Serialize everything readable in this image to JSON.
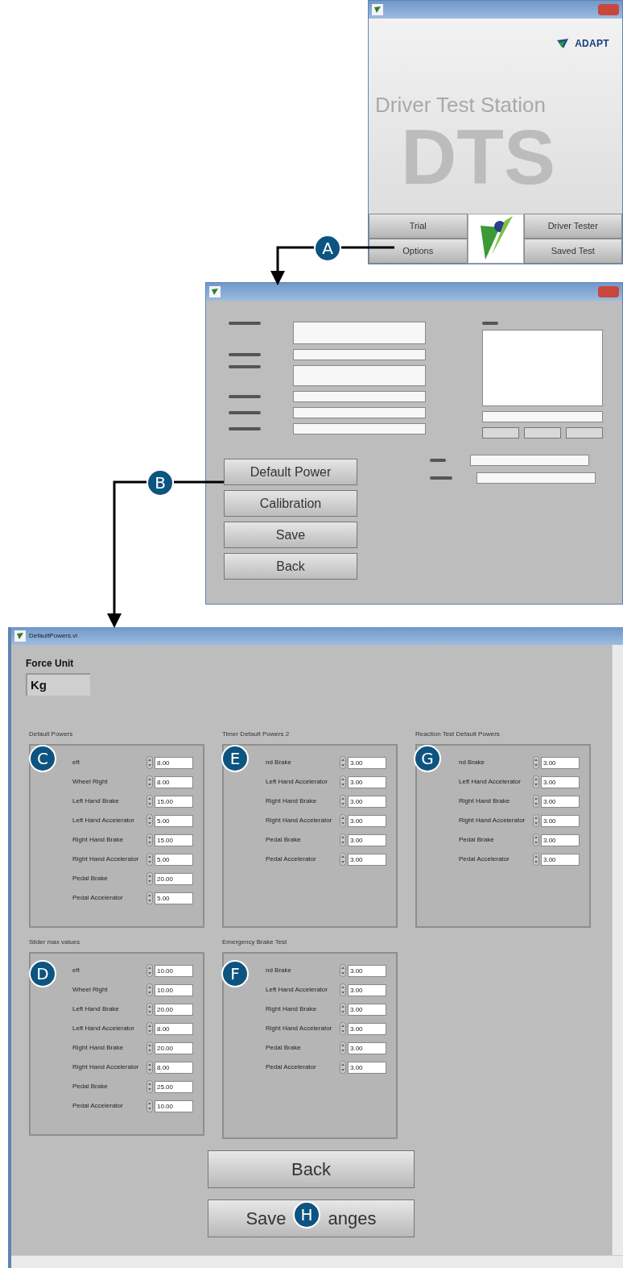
{
  "launcher": {
    "logo_text": "ADAPT",
    "watermark": "Driver Test Station",
    "watermark_letters": "DTS",
    "buttons": [
      {
        "label": "Trial"
      },
      {
        "label": "Driver Tester"
      },
      {
        "label": "Options"
      },
      {
        "label": "Saved Test"
      }
    ]
  },
  "options_window": {
    "buttons": [
      {
        "label": "Default Power"
      },
      {
        "label": "Calibration"
      },
      {
        "label": "Save"
      },
      {
        "label": "Back"
      }
    ]
  },
  "powers_window": {
    "title": "DefaultPowers.vi",
    "force_unit_label": "Force Unit",
    "force_unit_value": "Kg",
    "groups": [
      {
        "title": "Default Powers",
        "rows": [
          {
            "label": "eft",
            "value": "8.00"
          },
          {
            "label": "Wheel Right",
            "value": "8.00"
          },
          {
            "label": "Left Hand Brake",
            "value": "15.00"
          },
          {
            "label": "Left Hand Accelerator",
            "value": "5.00"
          },
          {
            "label": "Right Hand Brake",
            "value": "15.00"
          },
          {
            "label": "Right Hand Accelerator",
            "value": "5.00"
          },
          {
            "label": "Pedal Brake",
            "value": "20.00"
          },
          {
            "label": "Pedal Accelerator",
            "value": "5.00"
          }
        ]
      },
      {
        "title": "Timer Default Powers 2",
        "rows": [
          {
            "label": "nd Brake",
            "value": "3.00"
          },
          {
            "label": "Left Hand Accelerator",
            "value": "3.00"
          },
          {
            "label": "Right Hand Brake",
            "value": "3.00"
          },
          {
            "label": "Right Hand Accelerator",
            "value": "3.00"
          },
          {
            "label": "Pedal Brake",
            "value": "3.00"
          },
          {
            "label": "Pedal Accelerator",
            "value": "3.00"
          }
        ]
      },
      {
        "title": "Reaction Test Default Powers",
        "rows": [
          {
            "label": "nd Brake",
            "value": "3.00"
          },
          {
            "label": "Left Hand Accelerator",
            "value": "3.00"
          },
          {
            "label": "Right Hand Brake",
            "value": "3.00"
          },
          {
            "label": "Right Hand Accelerator",
            "value": "3.00"
          },
          {
            "label": "Pedal Brake",
            "value": "3.00"
          },
          {
            "label": "Pedal Accelerator",
            "value": "3.00"
          }
        ]
      },
      {
        "title": "Slider max values",
        "rows": [
          {
            "label": "eft",
            "value": "10.00"
          },
          {
            "label": "Wheel Right",
            "value": "10.00"
          },
          {
            "label": "Left Hand Brake",
            "value": "20.00"
          },
          {
            "label": "Left Hand Accelerator",
            "value": "8.00"
          },
          {
            "label": "Right Hand Brake",
            "value": "20.00"
          },
          {
            "label": "Right Hand Accelerator",
            "value": "8.00"
          },
          {
            "label": "Pedal Brake",
            "value": "25.00"
          },
          {
            "label": "Pedal Accelerator",
            "value": "10.00"
          }
        ]
      },
      {
        "title": "Emergency Brake Test",
        "rows": [
          {
            "label": "nd Brake",
            "value": "3.00"
          },
          {
            "label": "Left Hand Accelerator",
            "value": "3.00"
          },
          {
            "label": "Right Hand Brake",
            "value": "3.00"
          },
          {
            "label": "Right Hand Accelerator",
            "value": "3.00"
          },
          {
            "label": "Pedal Brake",
            "value": "3.00"
          },
          {
            "label": "Pedal Accelerator",
            "value": "3.00"
          }
        ]
      }
    ],
    "back_label": "Back",
    "save_label_start": "Save",
    "save_label_end": "anges"
  },
  "callouts": [
    {
      "letter": "A"
    },
    {
      "letter": "B"
    },
    {
      "letter": "C"
    },
    {
      "letter": "D"
    },
    {
      "letter": "E"
    },
    {
      "letter": "F"
    },
    {
      "letter": "G"
    },
    {
      "letter": "H"
    }
  ]
}
